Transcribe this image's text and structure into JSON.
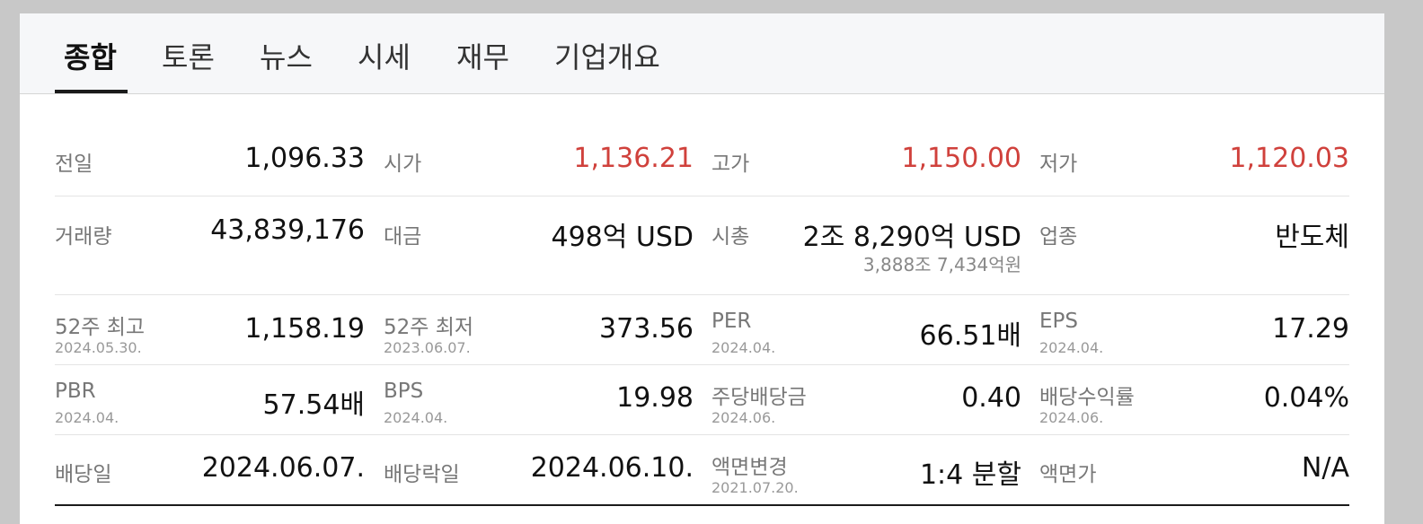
{
  "tabs": [
    "종합",
    "토론",
    "뉴스",
    "시세",
    "재무",
    "기업개요"
  ],
  "stats": {
    "prev_close": {
      "label": "전일",
      "value": "1,096.33"
    },
    "open": {
      "label": "시가",
      "value": "1,136.21"
    },
    "high": {
      "label": "고가",
      "value": "1,150.00"
    },
    "low": {
      "label": "저가",
      "value": "1,120.03"
    },
    "volume": {
      "label": "거래량",
      "value": "43,839,176"
    },
    "amount": {
      "label": "대금",
      "value": "498억 USD"
    },
    "market_cap": {
      "label": "시총",
      "value": "2조 8,290억 USD",
      "sub": "3,888조 7,434억원"
    },
    "sector": {
      "label": "업종",
      "value": "반도체"
    },
    "high_52w": {
      "label": "52주 최고",
      "date": "2024.05.30.",
      "value": "1,158.19"
    },
    "low_52w": {
      "label": "52주 최저",
      "date": "2023.06.07.",
      "value": "373.56"
    },
    "per": {
      "label": "PER",
      "date": "2024.04.",
      "value": "66.51배"
    },
    "eps": {
      "label": "EPS",
      "date": "2024.04.",
      "value": "17.29"
    },
    "pbr": {
      "label": "PBR",
      "date": "2024.04.",
      "value": "57.54배"
    },
    "bps": {
      "label": "BPS",
      "date": "2024.04.",
      "value": "19.98"
    },
    "dps": {
      "label": "주당배당금",
      "date": "2024.06.",
      "value": "0.40"
    },
    "div_yield": {
      "label": "배당수익률",
      "date": "2024.06.",
      "value": "0.04%"
    },
    "div_date": {
      "label": "배당일",
      "value": "2024.06.07."
    },
    "ex_div_date": {
      "label": "배당락일",
      "value": "2024.06.10."
    },
    "split": {
      "label": "액면변경",
      "date": "2021.07.20.",
      "value": "1:4 분할"
    },
    "par_value": {
      "label": "액면가",
      "value": "N/A"
    }
  },
  "colors": {
    "up": "#d0413c",
    "text": "#111111",
    "label": "#777777"
  }
}
